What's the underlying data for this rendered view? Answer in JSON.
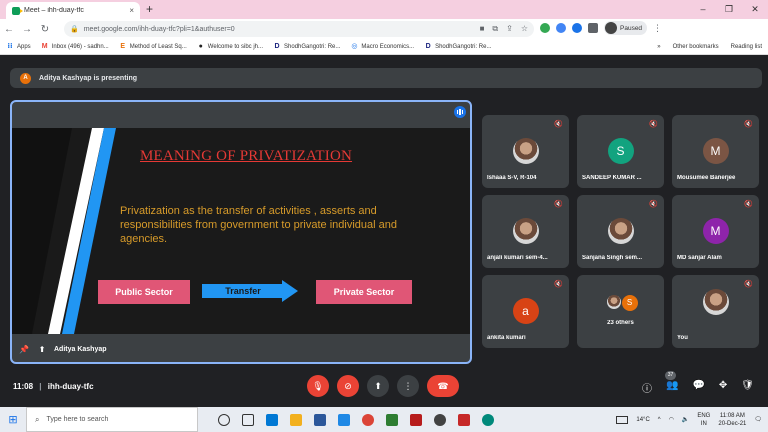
{
  "browser": {
    "tab_title": "Meet – ihh-duay-tfc",
    "tab_close": "×",
    "new_tab": "+",
    "url": "meet.google.com/ihh-duay-tfc?pli=1&authuser=0",
    "profile_status": "Paused",
    "window_controls": [
      "–",
      "❐",
      "✕"
    ]
  },
  "bookmarks": {
    "items": [
      {
        "icon": "apps-icon",
        "label": "Apps"
      },
      {
        "icon": "gmail-icon",
        "label": "Inbox (496) - sadhn..."
      },
      {
        "icon": "e-icon",
        "label": "Method of Least Sq..."
      },
      {
        "icon": "github-icon",
        "label": "Welcome to sibc jh..."
      },
      {
        "icon": "d-icon",
        "label": "ShodhGangotri: Re..."
      },
      {
        "icon": "globe-icon",
        "label": "Macro Economics..."
      },
      {
        "icon": "d-icon",
        "label": "ShodhGangotri: Re..."
      }
    ],
    "more": "»",
    "other": "Other bookmarks",
    "reading_list": "Reading list"
  },
  "meet": {
    "presenter_initial": "A",
    "presenting_text": "Aditya Kashyap is presenting",
    "stage_name": "Aditya Kashyap",
    "slide": {
      "title": "MEANING OF PRIVATIZATION",
      "body": "Privatization as the transfer of activities , asserts and responsibilities from government to private individual and agencies.",
      "left_box": "Public Sector",
      "arrow": "Transfer",
      "right_box": "Private Sector"
    },
    "participants": [
      {
        "name": "Ishaaa S-V, R-104",
        "initial": "",
        "color": "photo"
      },
      {
        "name": "SANDEEP KUMAR ...",
        "initial": "S",
        "color": "#12a37f"
      },
      {
        "name": "Mousumee Banerjee",
        "initial": "M",
        "color": "#7b5544"
      },
      {
        "name": "anjali kumari sem-4...",
        "initial": "",
        "color": "photo"
      },
      {
        "name": "Sanjana Singh sem...",
        "initial": "",
        "color": "photo"
      },
      {
        "name": "MD sanjar Alam",
        "initial": "M",
        "color": "#8e24aa"
      },
      {
        "name": "ankita kumari",
        "initial": "a",
        "color": "#d84315"
      },
      {
        "name": "23 others",
        "initial": "S",
        "color": "#e8710a"
      },
      {
        "name": "You",
        "initial": "",
        "color": "photo"
      }
    ],
    "time": "11:08",
    "meeting_code": "ihh-duay-tfc",
    "participant_count": "37"
  },
  "taskbar": {
    "search_placeholder": "Type here to search",
    "temperature": "14°C",
    "language": "ENG",
    "region": "IN",
    "time": "11:08 AM",
    "date": "20-Dec-21"
  },
  "colors": {
    "accent": "#8ab4f8",
    "end_call": "#ea4335",
    "slide_title": "#e53935",
    "box": "#e05676",
    "arrow": "#2196f3"
  }
}
